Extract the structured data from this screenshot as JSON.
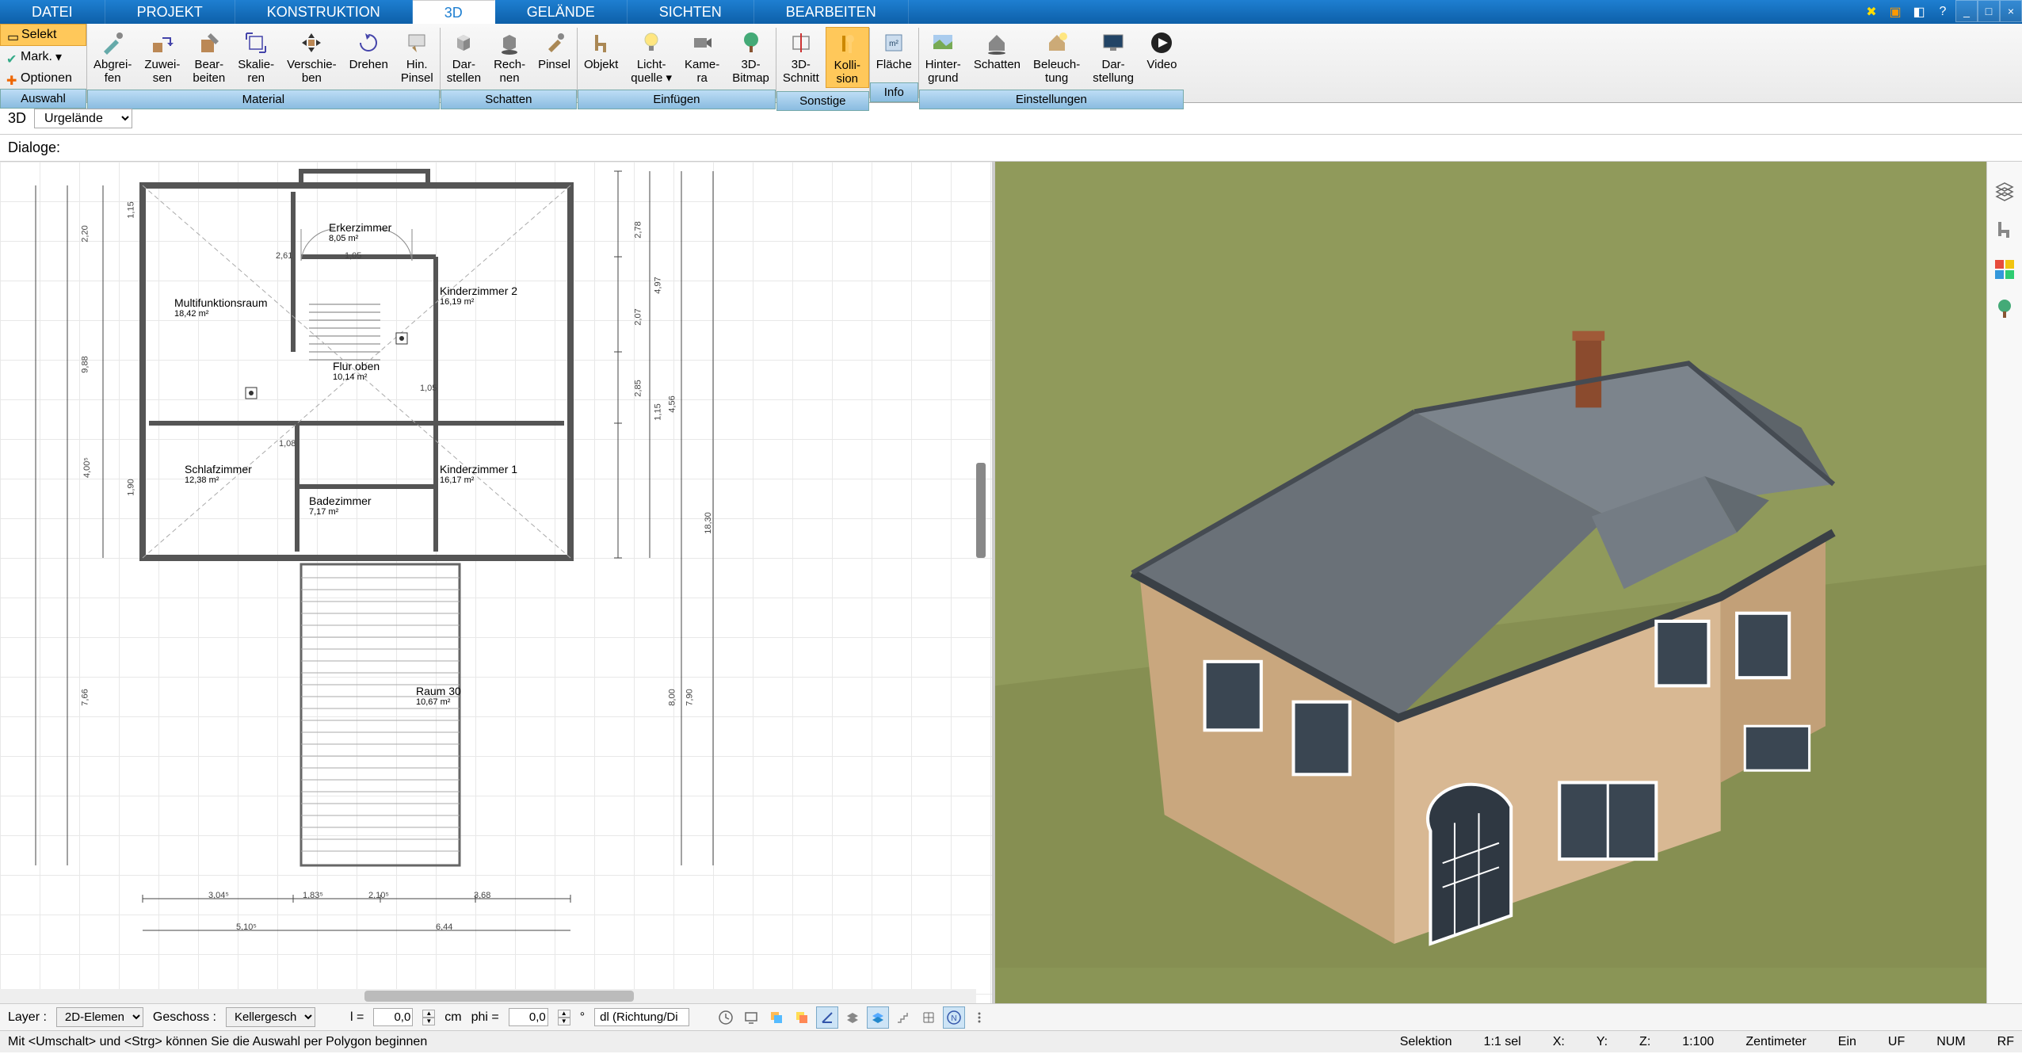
{
  "menu": {
    "datei": "DATEI",
    "projekt": "PROJEKT",
    "konstruktion": "KONSTRUKTION",
    "_3d": "3D",
    "gelaende": "GELÄNDE",
    "sichten": "SICHTEN",
    "bearbeiten": "BEARBEITEN"
  },
  "ribbon_side": {
    "selekt": "Selekt",
    "mark": "Mark.",
    "optionen": "Optionen"
  },
  "ribbon": {
    "auswahl": "Auswahl",
    "material": "Material",
    "material_btns": {
      "abgreifen": "Abgrei-\nfen",
      "zuweisen": "Zuwei-\nsen",
      "bearbeiten": "Bear-\nbeiten",
      "skalieren": "Skalie-\nren",
      "verschieben": "Verschie-\nben",
      "drehen": "Drehen",
      "hinpinsel": "Hin.\nPinsel"
    },
    "schatten": "Schatten",
    "schatten_btns": {
      "darstellen": "Dar-\nstellen",
      "rechnen": "Rech-\nnen",
      "pinsel": "Pinsel"
    },
    "einfuegen": "Einfügen",
    "einfuegen_btns": {
      "objekt": "Objekt",
      "lichtquelle": "Licht-\nquelle ▾",
      "kamera": "Kame-\nra",
      "bitmap3d": "3D-\nBitmap"
    },
    "sonstige": "Sonstige",
    "sonstige_btns": {
      "schnitt3d": "3D-\nSchnitt",
      "kollision": "Kolli-\nsion"
    },
    "info": "Info",
    "info_btns": {
      "flaeche": "Fläche"
    },
    "einstellungen": "Einstellungen",
    "einst_btns": {
      "hintergrund": "Hinter-\ngrund",
      "schatten2": "Schatten",
      "beleuchtung": "Beleuch-\ntung",
      "darstellung": "Dar-\nstellung",
      "video": "Video"
    }
  },
  "sub": {
    "_3d": "3D",
    "urgelaende": "Urgelände",
    "dialoge": "Dialoge:"
  },
  "rooms": {
    "erker": {
      "name": "Erkerzimmer",
      "area": "8,05 m²"
    },
    "multi": {
      "name": "Multifunktionsraum",
      "area": "18,42 m²"
    },
    "kinder2": {
      "name": "Kinderzimmer 2",
      "area": "16,19 m²"
    },
    "flur": {
      "name": "Flur oben",
      "area": "10,14 m²"
    },
    "schlaf": {
      "name": "Schlafzimmer",
      "area": "12,38 m²"
    },
    "bade": {
      "name": "Badezimmer",
      "area": "7,17 m²"
    },
    "kinder1": {
      "name": "Kinderzimmer 1",
      "area": "16,17 m²"
    },
    "raum30": {
      "name": "Raum 30",
      "area": "10,67 m²"
    }
  },
  "dims": {
    "d1": "3,04⁵",
    "d2": "1,83⁵",
    "d3": "2,10⁵",
    "d4": "3,68",
    "d5": "5,10⁵",
    "d6": "6,44",
    "v1": "2,78",
    "v2": "2,07",
    "v3": "2,85",
    "v4": "8,00",
    "v5": "18,30",
    "v6": "4,56",
    "l1": "9,88",
    "l2": "2,20",
    "l3": "4,00⁵",
    "l4": "7,66",
    "s1": "1,15",
    "s2": "4,97",
    "s3": "1,90",
    "s4": "7,90",
    "s5": "1,15",
    "w1": "2,61",
    "w2": "1,05",
    "w3": "1,08",
    "w4": "1,05"
  },
  "params": {
    "layer_label": "Layer :",
    "layer_value": "2D-Elemen",
    "geschoss_label": "Geschoss :",
    "geschoss_value": "Kellergesch",
    "l_label": "l =",
    "l_value": "0,0",
    "cm": "cm",
    "phi_label": "phi =",
    "phi_value": "0,0",
    "deg": "°",
    "dl": "dl (Richtung/Di"
  },
  "status": {
    "hint": "Mit <Umschalt> und <Strg> können Sie die Auswahl per Polygon beginnen",
    "selektion": "Selektion",
    "sel": "1:1 sel",
    "x": "X:",
    "y": "Y:",
    "z": "Z:",
    "scale": "1:100",
    "unit": "Zentimeter",
    "ein": "Ein",
    "uf": "UF",
    "num": "NUM",
    "rf": "RF"
  }
}
